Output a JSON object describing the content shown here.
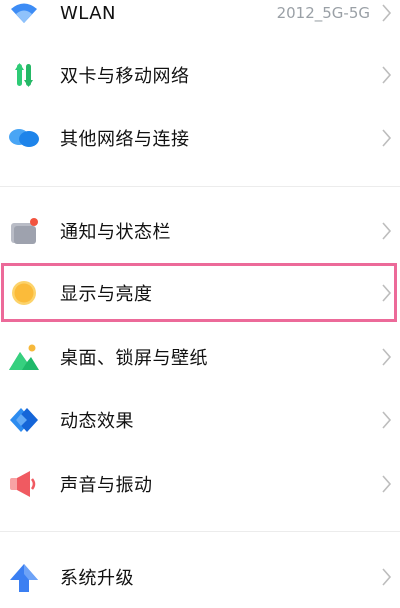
{
  "settings": {
    "wlan": {
      "label": "WLAN",
      "value": "2012_5G-5G",
      "icon": "wifi-icon"
    },
    "dual_sim": {
      "label": "双卡与移动网络",
      "icon": "mobile-network-icon"
    },
    "other_networks": {
      "label": "其他网络与连接",
      "icon": "connection-icon"
    },
    "notifications": {
      "label": "通知与状态栏",
      "icon": "notification-icon"
    },
    "display": {
      "label": "显示与亮度",
      "icon": "display-brightness-icon"
    },
    "wallpaper": {
      "label": "桌面、锁屏与壁纸",
      "icon": "wallpaper-icon"
    },
    "effects": {
      "label": "动态效果",
      "icon": "effects-icon"
    },
    "sound": {
      "label": "声音与振动",
      "icon": "sound-icon"
    },
    "update": {
      "label": "系统升级",
      "icon": "system-update-icon"
    }
  },
  "highlight_color": "#ec6a99"
}
